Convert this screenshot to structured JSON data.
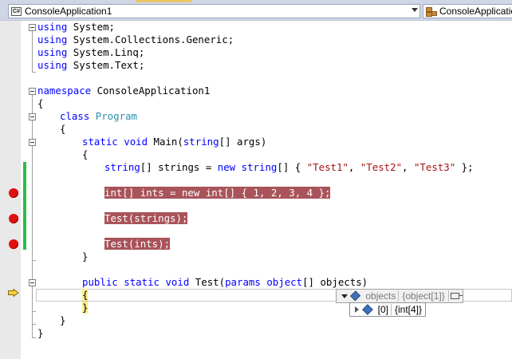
{
  "navbar": {
    "project_combo": {
      "icon": "csharp-file-icon",
      "icon_text": "C#",
      "value": "ConsoleApplication1"
    },
    "member_combo": {
      "icon": "class-icon",
      "value": "ConsoleApplicatio"
    }
  },
  "editor": {
    "lines": {
      "l1": {
        "kw": "using",
        "rest": " System;"
      },
      "l2": {
        "kw": "using",
        "rest": " System.Collections.Generic;"
      },
      "l3": {
        "kw": "using",
        "rest": " System.Linq;"
      },
      "l4": {
        "kw": "using",
        "rest": " System.Text;"
      },
      "l6": {
        "kw": "namespace",
        "rest": " ConsoleApplication1"
      },
      "l7": {
        "text": "{"
      },
      "l8": {
        "kw": "class",
        "type": "Program"
      },
      "l9": {
        "text": "{"
      },
      "l10": {
        "kw1": "static",
        "kw2": "void",
        "name": " Main(",
        "kw3": "string",
        "rest": "[] args)"
      },
      "l11": {
        "text": "{"
      },
      "l12": {
        "kw1": "string",
        "p1": "[] strings = ",
        "kw2": "new",
        "kw3": "string",
        "p2": "[] { ",
        "s1": "\"Test1\"",
        "c1": ", ",
        "s2": "\"Test2\"",
        "c2": ", ",
        "s3": "\"Test3\"",
        "p3": " };"
      },
      "l14": {
        "text": "int[] ints = new int[] { 1, 2, 3, 4 };"
      },
      "l16": {
        "text": "Test(strings);"
      },
      "l18": {
        "text": "Test(ints);"
      },
      "l19": {
        "text": "}"
      },
      "l21": {
        "kw1": "public",
        "kw2": "static",
        "kw3": "void",
        "name": " Test(",
        "kw4": "params",
        "kw5": "object",
        "rest": "[] objects)"
      },
      "l22": {
        "text": "{"
      },
      "l23": {
        "text": "}"
      },
      "l24": {
        "text": "}"
      },
      "l25": {
        "text": "}"
      }
    }
  },
  "datatip": {
    "root": {
      "expander": "expanded",
      "icon": "object-icon",
      "name": "objects",
      "value": "{object[1]}",
      "pin_icon": "pin-icon"
    },
    "child": {
      "expander": "collapsed",
      "icon": "object-icon",
      "name": "[0]",
      "value": "{int[4]}"
    }
  },
  "colors": {
    "keyword": "#0000ff",
    "type": "#2b91af",
    "string": "#a31515",
    "breakpoint_line_bg": "#a9545a",
    "breakpoint": "#e01010",
    "execution_arrow": "#f5d142",
    "change_bar": "#2bbd4a",
    "current_brace_highlight": "#f7f08c"
  }
}
